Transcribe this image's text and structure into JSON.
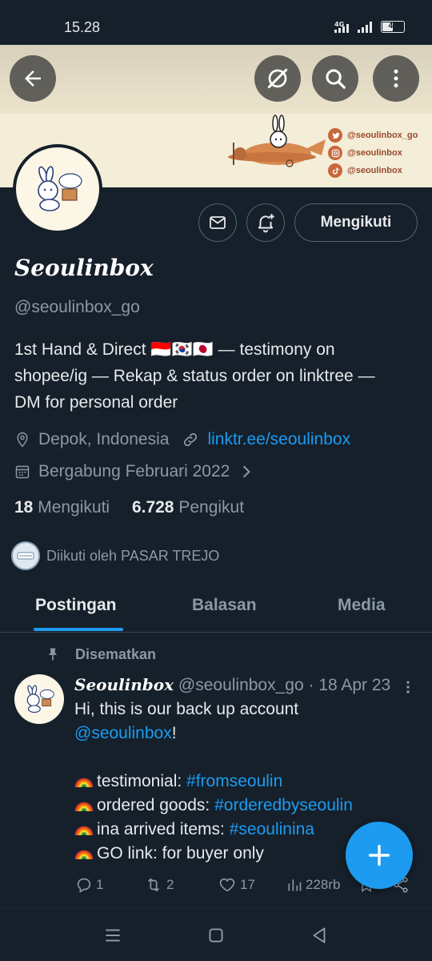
{
  "status_bar": {
    "time": "15.28",
    "network": "4G",
    "battery": "46",
    "battery_level": 0.46
  },
  "banner": {
    "handles": [
      "@seoulinbox_go",
      "@seoulinbox",
      "@seoulinbox"
    ],
    "handle_icons": [
      "twitter-icon",
      "instagram-icon",
      "tiktok-icon"
    ]
  },
  "profile": {
    "name": "Seoulinbox",
    "handle": "@seoulinbox_go",
    "bio_line1": "1st Hand & Direct 🇮🇩🇰🇷🇯🇵 — testimony on",
    "bio_line2": "shopee/ig — Rekap & status order on linktree —",
    "bio_line3": "DM for personal order",
    "location": "Depok, Indonesia",
    "website": "linktr.ee/seoulinbox",
    "joined": "Bergabung Februari 2022",
    "following_count": "18",
    "following_label": "Mengikuti",
    "followers_count": "6.728",
    "followers_label": "Pengikut",
    "followed_by": "Diikuti oleh PASAR TREJO",
    "follow_button": "Mengikuti"
  },
  "tabs": [
    {
      "label": "Postingan",
      "active": true
    },
    {
      "label": "Balasan",
      "active": false
    },
    {
      "label": "Media",
      "active": false
    }
  ],
  "pinned_post": {
    "pinned_label": "Disematkan",
    "author_name": "Seoulinbox",
    "author_meta": "@seoulinbox_go · 18 Apr 23",
    "line1": "Hi, this is our back up account",
    "line2_mention": "@seoulinbox",
    "line2_suffix": "!",
    "items": [
      {
        "text": "testimonial: ",
        "tag": "#fromseoulin"
      },
      {
        "text": "ordered goods: ",
        "tag": "#orderedbyseoulin"
      },
      {
        "text": "ina arrived items: ",
        "tag": "#seoulinina"
      },
      {
        "text": "GO link: for buyer only",
        "tag": ""
      }
    ],
    "replies": "1",
    "reposts": "2",
    "likes": "17",
    "views": "228rb"
  },
  "colors": {
    "background": "#15202b",
    "accent": "#1d9bf0",
    "muted": "#8b98a5",
    "banner": "#f4edd8"
  }
}
